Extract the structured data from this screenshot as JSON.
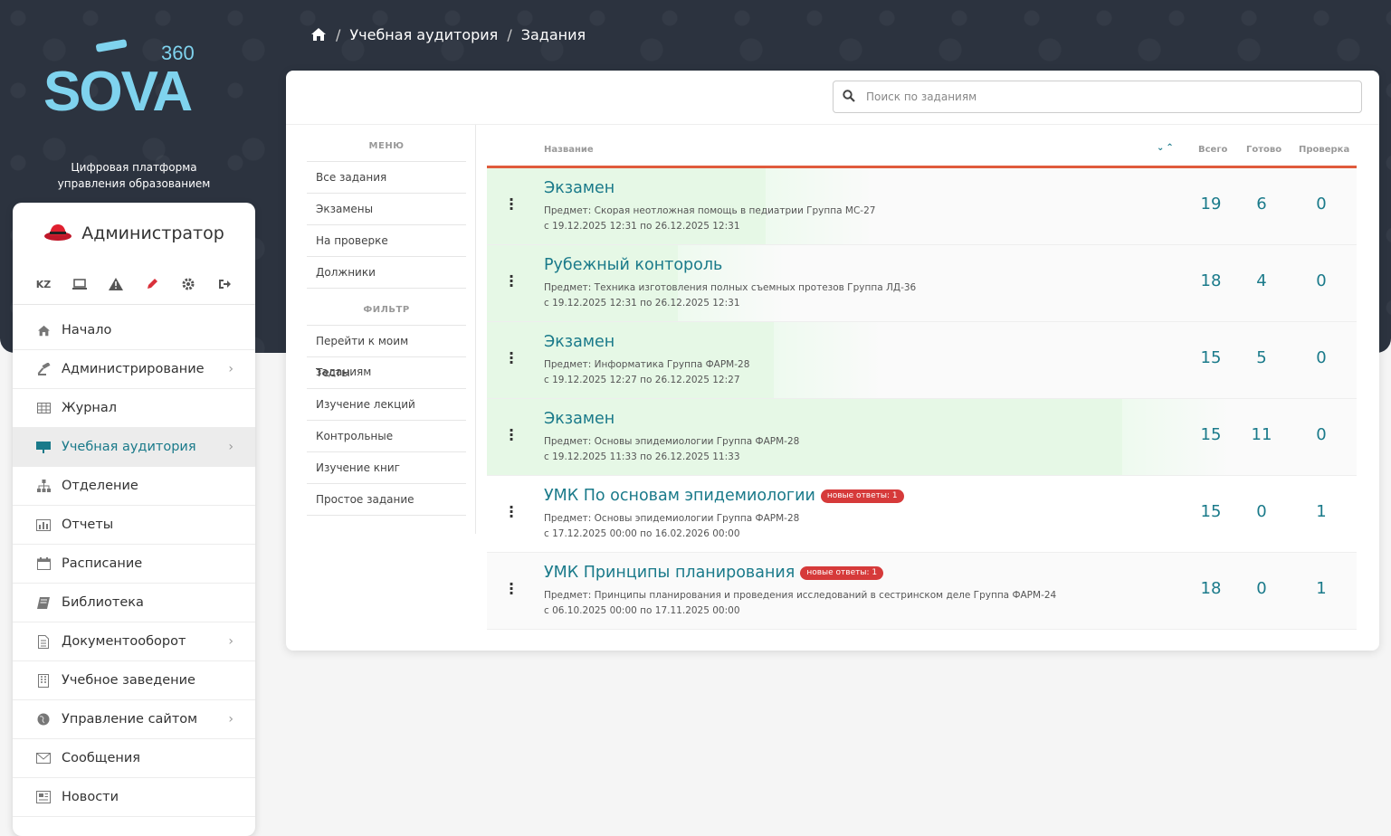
{
  "brand": {
    "logo_text": "SOVA",
    "logo_sup": "360",
    "tagline_1": "Цифровая платформа",
    "tagline_2": "управления образованием",
    "accent": "#7fd3ee"
  },
  "breadcrumb": {
    "items": [
      "Учебная аудитория",
      "Задания"
    ]
  },
  "user": {
    "name": "Администратор"
  },
  "tools": {
    "lang": "KZ"
  },
  "nav": {
    "items": [
      {
        "label": "Начало"
      },
      {
        "label": "Администрирование"
      },
      {
        "label": "Журнал"
      },
      {
        "label": "Учебная аудитория"
      },
      {
        "label": "Отделение"
      },
      {
        "label": "Отчеты"
      },
      {
        "label": "Расписание"
      },
      {
        "label": "Библиотека"
      },
      {
        "label": "Документооборот"
      },
      {
        "label": "Учебное заведение"
      },
      {
        "label": "Управление сайтом"
      },
      {
        "label": "Сообщения"
      },
      {
        "label": "Новости"
      }
    ]
  },
  "search": {
    "placeholder": "Поиск по заданиям",
    "value": ""
  },
  "menu": {
    "heading": "МЕНЮ",
    "items": [
      "Все задания",
      "Экзамены",
      "На проверке",
      "Должники"
    ]
  },
  "filter": {
    "heading": "ФИЛЬТР",
    "items": [
      "Перейти к моим заданиям",
      "Тесты",
      "Изучение лекций",
      "Контрольные",
      "Изучение книг",
      "Простое задание"
    ]
  },
  "table": {
    "headers": {
      "name": "Название",
      "total": "Всего",
      "done": "Готово",
      "check": "Проверка"
    },
    "rows": [
      {
        "title": "Экзамен",
        "badge": "",
        "subject": "Предмет: Скорая неотложная помощь в педиатрии Группа МС-27",
        "dates": "с 19.12.2025 12:31 по 26.12.2025 12:31",
        "total": "19",
        "done": "6",
        "check": "0",
        "progress": 0.32
      },
      {
        "title": "Рубежный контороль",
        "badge": "",
        "subject": "Предмет: Техника изготовления полных съемных протезов Группа ЛД-36",
        "dates": "с 19.12.2025 12:31 по 26.12.2025 12:31",
        "total": "18",
        "done": "4",
        "check": "0",
        "progress": 0.22
      },
      {
        "title": "Экзамен",
        "badge": "",
        "subject": "Предмет: Информатика Группа ФАРМ-28",
        "dates": "с 19.12.2025 12:27 по 26.12.2025 12:27",
        "total": "15",
        "done": "5",
        "check": "0",
        "progress": 0.33
      },
      {
        "title": "Экзамен",
        "badge": "",
        "subject": "Предмет: Основы эпидемиологии Группа ФАРМ-28",
        "dates": "с 19.12.2025 11:33 по 26.12.2025 11:33",
        "total": "15",
        "done": "11",
        "check": "0",
        "progress": 0.73
      },
      {
        "title": "УМК По основам эпидемиологии",
        "badge": "новые ответы: 1",
        "subject": "Предмет: Основы эпидемиологии Группа ФАРМ-28",
        "dates": "с 17.12.2025 00:00 по 16.02.2026 00:00",
        "total": "15",
        "done": "0",
        "check": "1",
        "progress": 0
      },
      {
        "title": "УМК Принципы планирования",
        "badge": "новые ответы: 1",
        "subject": "Предмет: Принципы планирования и проведения исследований в сестринском деле Группа ФАРМ-24",
        "dates": "с 06.10.2025 00:00 по 17.11.2025 00:00",
        "total": "18",
        "done": "0",
        "check": "1",
        "progress": 0
      }
    ]
  }
}
